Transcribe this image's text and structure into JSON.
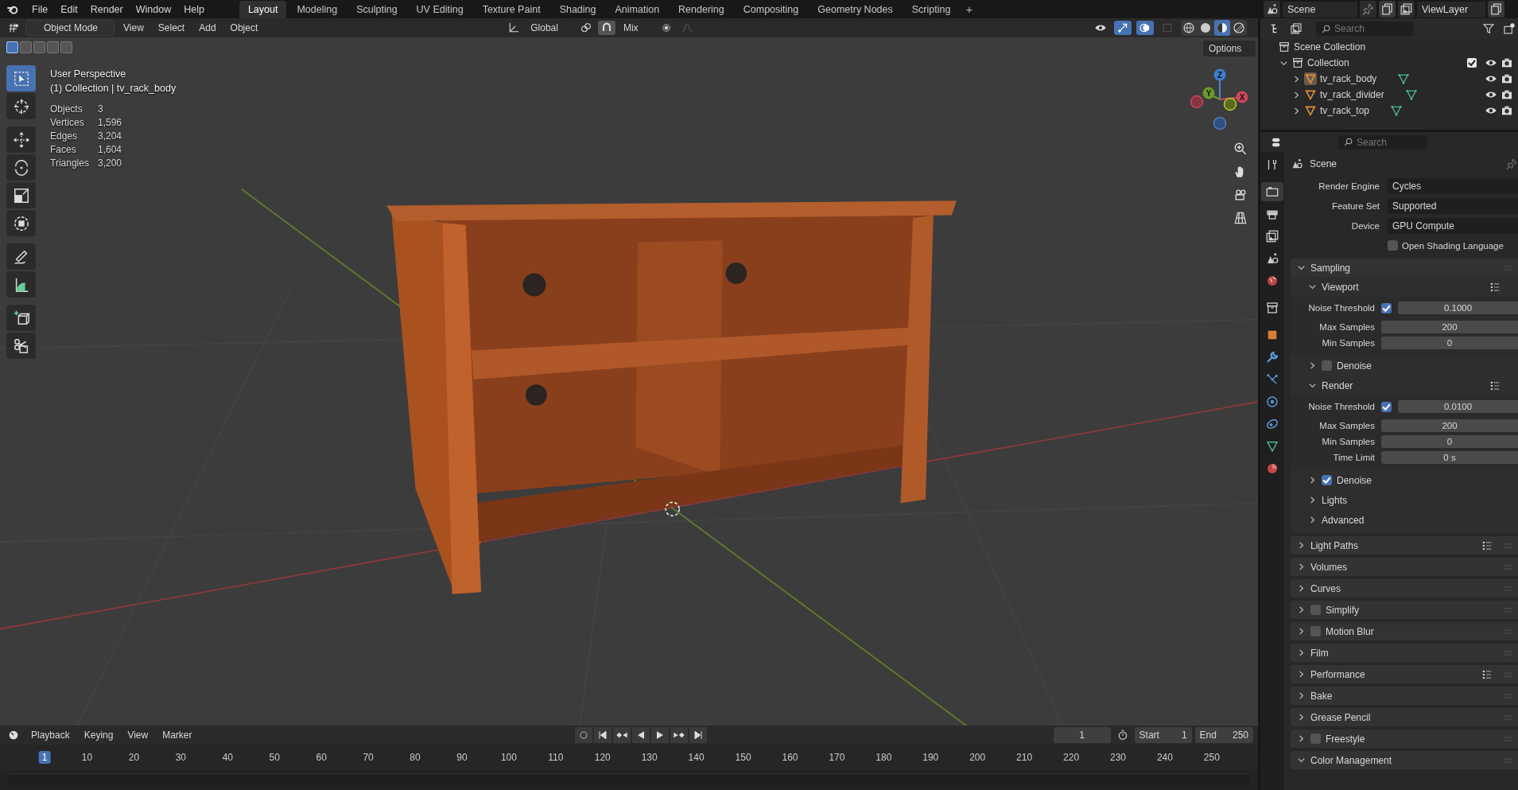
{
  "menu": [
    "File",
    "Edit",
    "Render",
    "Window",
    "Help"
  ],
  "workspaces": [
    {
      "label": "Layout",
      "selected": true
    },
    {
      "label": "Modeling",
      "selected": false
    },
    {
      "label": "Sculpting",
      "selected": false
    },
    {
      "label": "UV Editing",
      "selected": false
    },
    {
      "label": "Texture Paint",
      "selected": false
    },
    {
      "label": "Shading",
      "selected": false
    },
    {
      "label": "Animation",
      "selected": false
    },
    {
      "label": "Rendering",
      "selected": false
    },
    {
      "label": "Compositing",
      "selected": false
    },
    {
      "label": "Geometry Nodes",
      "selected": false
    },
    {
      "label": "Scripting",
      "selected": false
    }
  ],
  "add_workspace": "+",
  "scene": {
    "name": "Scene"
  },
  "view_layer": {
    "name": "ViewLayer"
  },
  "viewport_header": {
    "mode": "Object Mode",
    "menus": [
      "View",
      "Select",
      "Add",
      "Object"
    ],
    "orientation": "Global",
    "snap": "Mix",
    "options": "Options"
  },
  "select_modes": [
    {
      "selected": true
    },
    {
      "selected": false
    },
    {
      "selected": false
    },
    {
      "selected": false
    },
    {
      "selected": false
    }
  ],
  "tools": [
    {
      "selected": true
    },
    {
      "selected": false
    },
    {
      "selected": false
    },
    {
      "selected": false
    },
    {
      "selected": false
    },
    {
      "selected": false
    },
    {
      "selected": false
    },
    {
      "selected": false
    },
    {
      "selected": false
    },
    {
      "selected": false
    }
  ],
  "shading_modes": [
    {
      "selected": false
    },
    {
      "selected": false
    },
    {
      "selected": true
    },
    {
      "selected": false
    }
  ],
  "overlay": {
    "view": "User Perspective",
    "context": "(1) Collection | tv_rack_body",
    "stats": [
      {
        "label": "Objects",
        "value": "3"
      },
      {
        "label": "Vertices",
        "value": "1,596"
      },
      {
        "label": "Edges",
        "value": "3,204"
      },
      {
        "label": "Faces",
        "value": "1,604"
      },
      {
        "label": "Triangles",
        "value": "3,200"
      }
    ]
  },
  "gizmo": {
    "z": "Z",
    "y": "Y",
    "x": "X"
  },
  "outliner": {
    "search": {
      "placeholder": "Search"
    },
    "root": "Scene Collection",
    "collections": [
      {
        "name": "Collection",
        "expanded": true,
        "checked": true,
        "children": [
          {
            "name": "tv_rack_body",
            "selected": true
          },
          {
            "name": "tv_rack_divider",
            "selected": false
          },
          {
            "name": "tv_rack_top",
            "selected": false
          }
        ]
      }
    ]
  },
  "properties": {
    "search": {
      "placeholder": "Search"
    },
    "tabs": [
      {
        "selected": false
      },
      {
        "selected": true
      },
      {
        "selected": false
      },
      {
        "selected": false
      },
      {
        "selected": false
      },
      {
        "selected": false
      },
      {
        "selected": false
      },
      {
        "selected": false
      },
      {
        "selected": false
      },
      {
        "selected": false
      },
      {
        "selected": false
      },
      {
        "selected": false
      },
      {
        "selected": false
      },
      {
        "selected": false
      }
    ],
    "context": "Scene",
    "fields": [
      {
        "label": "Render Engine",
        "value": "Cycles"
      },
      {
        "label": "Feature Set",
        "value": "Supported"
      },
      {
        "label": "Device",
        "value": "GPU Compute"
      }
    ],
    "osl": {
      "label": "Open Shading Language",
      "checked": false
    },
    "panels": [
      {
        "title": "Sampling",
        "expanded": true,
        "presets": false,
        "children": [
          {
            "title": "Viewport",
            "expanded": true,
            "presets": true,
            "rows": [
              {
                "label": "Noise Threshold",
                "kind": "toggle",
                "checked": true,
                "value": "0.1000"
              },
              {
                "label": "Max Samples",
                "kind": "number",
                "value": "200"
              },
              {
                "label": "Min Samples",
                "kind": "number",
                "value": "0"
              }
            ]
          },
          {
            "title": "Denoise",
            "expanded": false,
            "presets": false,
            "checked": false
          },
          {
            "title": "Render",
            "expanded": true,
            "presets": true,
            "rows": [
              {
                "label": "Noise Threshold",
                "kind": "toggle",
                "checked": true,
                "value": "0.0100"
              },
              {
                "label": "Max Samples",
                "kind": "number",
                "value": "200"
              },
              {
                "label": "Min Samples",
                "kind": "number",
                "value": "0"
              },
              {
                "label": "Time Limit",
                "kind": "number",
                "value": "0 s"
              }
            ]
          },
          {
            "title": "Denoise",
            "expanded": false,
            "presets": false,
            "checked": true
          },
          {
            "title": "Lights",
            "expanded": false,
            "presets": false
          },
          {
            "title": "Advanced",
            "expanded": false,
            "presets": false
          }
        ]
      },
      {
        "title": "Light Paths",
        "expanded": false,
        "presets": true
      },
      {
        "title": "Volumes",
        "expanded": false,
        "presets": false
      },
      {
        "title": "Curves",
        "expanded": false,
        "presets": false
      },
      {
        "title": "Simplify",
        "expanded": false,
        "presets": false,
        "checked": false
      },
      {
        "title": "Motion Blur",
        "expanded": false,
        "presets": false,
        "checked": false
      },
      {
        "title": "Film",
        "expanded": false,
        "presets": false
      },
      {
        "title": "Performance",
        "expanded": false,
        "presets": true
      },
      {
        "title": "Bake",
        "expanded": false,
        "presets": false
      },
      {
        "title": "Grease Pencil",
        "expanded": false,
        "presets": false
      },
      {
        "title": "Freestyle",
        "expanded": false,
        "presets": false,
        "checked": false
      },
      {
        "title": "Color Management",
        "expanded": true,
        "presets": false
      }
    ]
  },
  "timeline": {
    "menus": [
      "Playback",
      "Keying",
      "View",
      "Marker"
    ],
    "current_frame": "1",
    "start_label": "Start",
    "start": "1",
    "end_label": "End",
    "end": "250",
    "ruler": [
      {
        "label": "1",
        "selected": true
      },
      {
        "label": "10",
        "selected": false
      },
      {
        "label": "20",
        "selected": false
      },
      {
        "label": "30",
        "selected": false
      },
      {
        "label": "40",
        "selected": false
      },
      {
        "label": "50",
        "selected": false
      },
      {
        "label": "60",
        "selected": false
      },
      {
        "label": "70",
        "selected": false
      },
      {
        "label": "80",
        "selected": false
      },
      {
        "label": "90",
        "selected": false
      },
      {
        "label": "100",
        "selected": false
      },
      {
        "label": "110",
        "selected": false
      },
      {
        "label": "120",
        "selected": false
      },
      {
        "label": "130",
        "selected": false
      },
      {
        "label": "140",
        "selected": false
      },
      {
        "label": "150",
        "selected": false
      },
      {
        "label": "160",
        "selected": false
      },
      {
        "label": "170",
        "selected": false
      },
      {
        "label": "180",
        "selected": false
      },
      {
        "label": "190",
        "selected": false
      },
      {
        "label": "200",
        "selected": false
      },
      {
        "label": "210",
        "selected": false
      },
      {
        "label": "220",
        "selected": false
      },
      {
        "label": "230",
        "selected": false
      },
      {
        "label": "240",
        "selected": false
      },
      {
        "label": "250",
        "selected": false
      }
    ]
  }
}
